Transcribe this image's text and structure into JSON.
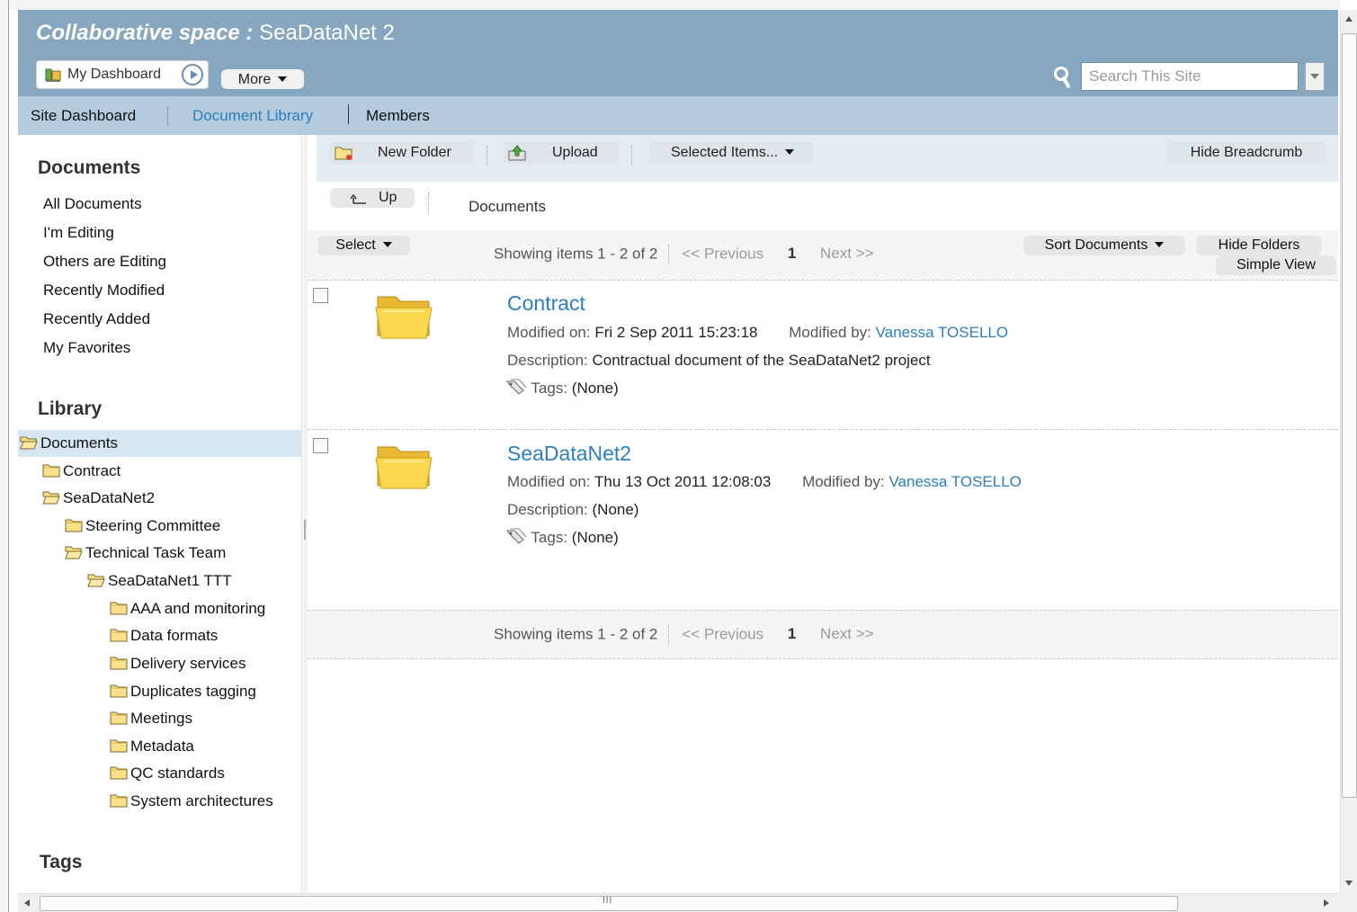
{
  "header": {
    "title_prefix": "Collaborative space :",
    "site_name": "SeaDataNet 2",
    "dashboard_label": "My Dashboard",
    "more_label": "More",
    "search_placeholder": "Search This Site"
  },
  "nav": {
    "items": [
      {
        "label": "Site Dashboard"
      },
      {
        "label": "Document Library"
      },
      {
        "label": "Members"
      }
    ]
  },
  "sidebar": {
    "documents_heading": "Documents",
    "filters": [
      "All Documents",
      "I'm Editing",
      "Others are Editing",
      "Recently Modified",
      "Recently Added",
      "My Favorites"
    ],
    "library_heading": "Library",
    "tree": [
      "Documents",
      "Contract",
      "SeaDataNet2",
      "Steering Committee",
      "Technical Task Team",
      "SeaDataNet1 TTT",
      "AAA and monitoring",
      "Data formats",
      "Delivery services",
      "Duplicates tagging",
      "Meetings",
      "Metadata",
      "QC standards",
      "System architectures"
    ],
    "tags_heading": "Tags"
  },
  "toolbar": {
    "new_folder": "New Folder",
    "upload": "Upload",
    "selected_items": "Selected Items...",
    "hide_breadcrumb": "Hide Breadcrumb",
    "up": "Up",
    "breadcrumb": "Documents"
  },
  "list": {
    "select": "Select",
    "showing": "Showing items 1 - 2 of 2",
    "previous": "<< Previous",
    "page": "1",
    "next": "Next >>",
    "sort": "Sort Documents",
    "hide_folders": "Hide Folders",
    "simple_view": "Simple View"
  },
  "documents": [
    {
      "name": "Contract",
      "modified_on_label": "Modified on:",
      "modified_on": "Fri 2 Sep 2011 15:23:18",
      "modified_by_label": "Modified by:",
      "modified_by": "Vanessa TOSELLO",
      "description_label": "Description:",
      "description": "Contractual document of the SeaDataNet2 project",
      "tags_label": "Tags:",
      "tags": "(None)"
    },
    {
      "name": "SeaDataNet2",
      "modified_on_label": "Modified on:",
      "modified_on": "Thu 13 Oct 2011 12:08:03",
      "modified_by_label": "Modified by:",
      "modified_by": "Vanessa TOSELLO",
      "description_label": "Description:",
      "description": "(None)",
      "tags_label": "Tags:",
      "tags": "(None)"
    }
  ],
  "colors": {
    "header_bg": "#87a7c1",
    "nav_bg": "#b3cbdd",
    "link": "#2c7fbf",
    "selected_row": "#d6e6f3"
  }
}
